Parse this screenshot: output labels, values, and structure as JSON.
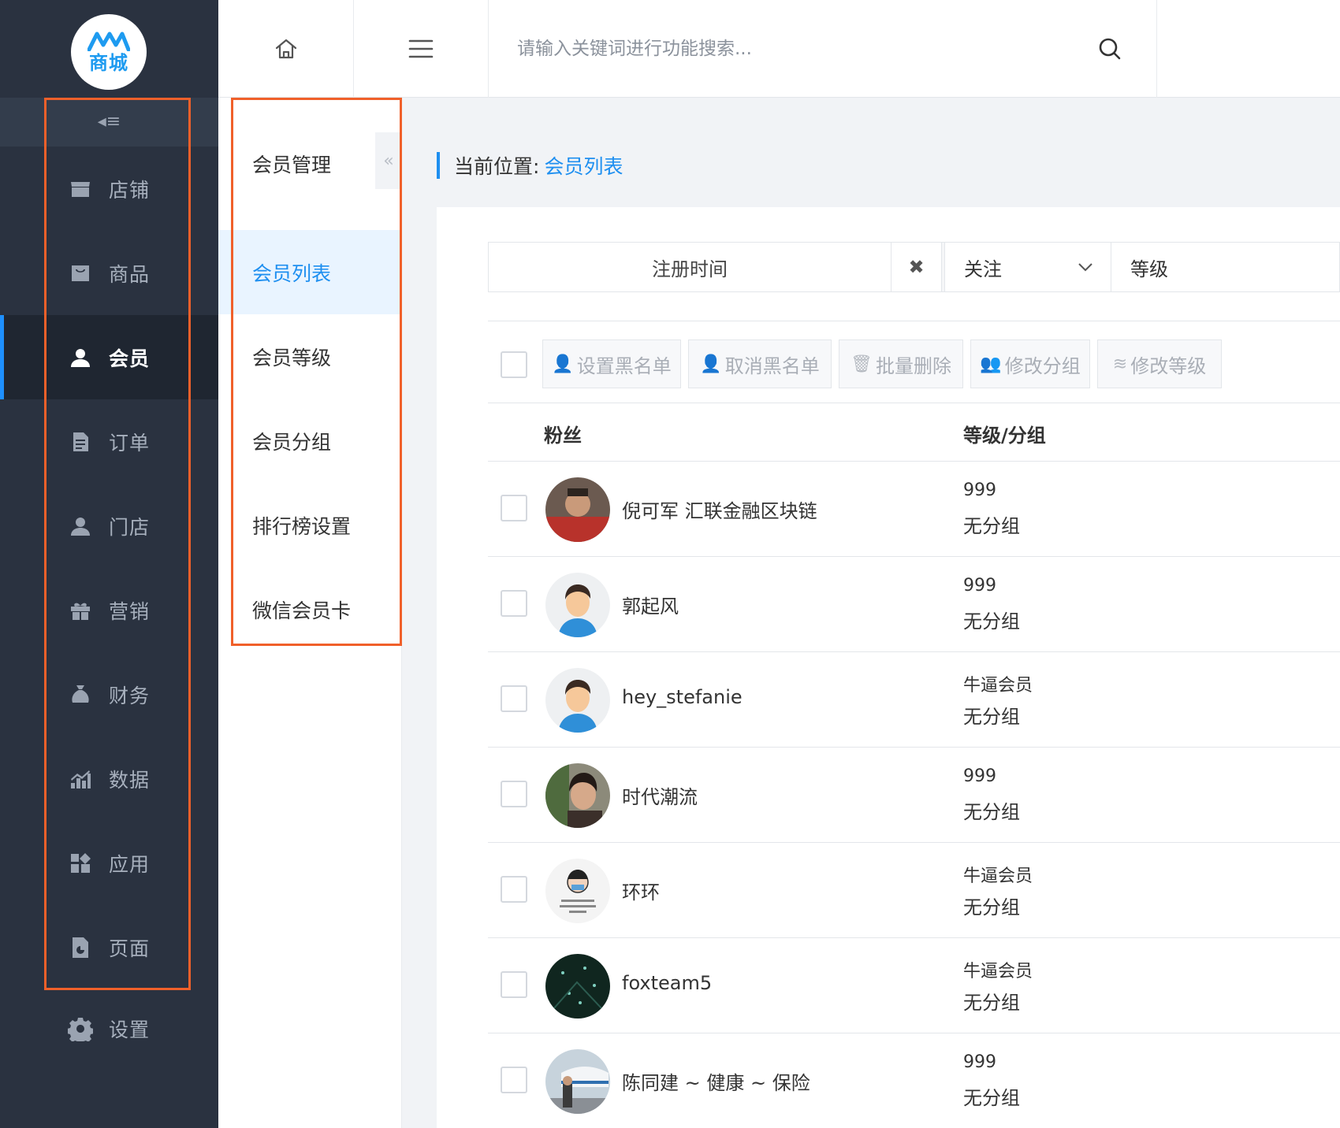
{
  "logo": {
    "text": "商城"
  },
  "sidebar": {
    "items": [
      {
        "label": "店铺",
        "icon": "store-icon",
        "active": false
      },
      {
        "label": "商品",
        "icon": "goods-icon",
        "active": false
      },
      {
        "label": "会员",
        "icon": "member-icon",
        "active": true
      },
      {
        "label": "订单",
        "icon": "order-icon",
        "active": false
      },
      {
        "label": "门店",
        "icon": "shop-user-icon",
        "active": false
      },
      {
        "label": "营销",
        "icon": "gift-icon",
        "active": false
      },
      {
        "label": "财务",
        "icon": "money-bag-icon",
        "active": false
      },
      {
        "label": "数据",
        "icon": "chart-icon",
        "active": false
      },
      {
        "label": "应用",
        "icon": "apps-icon",
        "active": false
      },
      {
        "label": "页面",
        "icon": "page-icon",
        "active": false
      }
    ],
    "settings": {
      "label": "设置",
      "icon": "gear-icon"
    }
  },
  "topbar": {
    "search_placeholder": "请输入关键词进行功能搜索..."
  },
  "submenu": {
    "title": "会员管理",
    "items": [
      {
        "label": "会员列表",
        "active": true
      },
      {
        "label": "会员等级",
        "active": false
      },
      {
        "label": "会员分组",
        "active": false
      },
      {
        "label": "排行榜设置",
        "active": false
      },
      {
        "label": "微信会员卡",
        "active": false
      }
    ]
  },
  "breadcrumb": {
    "prefix": "当前位置:",
    "current": "会员列表"
  },
  "filters": {
    "date_label": "注册时间",
    "clear_glyph": "✖",
    "follow_label": "关注",
    "level_label": "等级"
  },
  "actions": [
    {
      "label": "设置黑名单",
      "icon": "user-block-icon"
    },
    {
      "label": "取消黑名单",
      "icon": "user-unblock-icon"
    },
    {
      "label": "批量删除",
      "icon": "trash-icon"
    },
    {
      "label": "修改分组",
      "icon": "group-icon"
    },
    {
      "label": "修改等级",
      "icon": "layers-icon"
    }
  ],
  "table": {
    "columns": {
      "fans": "粉丝",
      "level_group": "等级/分组"
    },
    "rows": [
      {
        "nickname": "倪可军 汇联金融区块链",
        "level": "999",
        "group": "无分组",
        "avatar": "photo-red"
      },
      {
        "nickname": "郭起风",
        "level": "999",
        "group": "无分组",
        "avatar": "default"
      },
      {
        "nickname": "hey_stefanie",
        "level": "牛逼会员",
        "group": "无分组",
        "avatar": "default"
      },
      {
        "nickname": "时代潮流",
        "level": "999",
        "group": "无分组",
        "avatar": "photo-woman"
      },
      {
        "nickname": "环环",
        "level": "牛逼会员",
        "group": "无分组",
        "avatar": "cartoon"
      },
      {
        "nickname": "foxteam5",
        "level": "牛逼会员",
        "group": "无分组",
        "avatar": "photo-dark"
      },
      {
        "nickname": "陈同建 ~ 健康 ~ 保险",
        "level": "999",
        "group": "无分组",
        "avatar": "photo-train"
      }
    ]
  },
  "colors": {
    "sidebar_bg": "#2a3240",
    "accent": "#1e8ff0",
    "highlight_box": "#f0602a"
  }
}
